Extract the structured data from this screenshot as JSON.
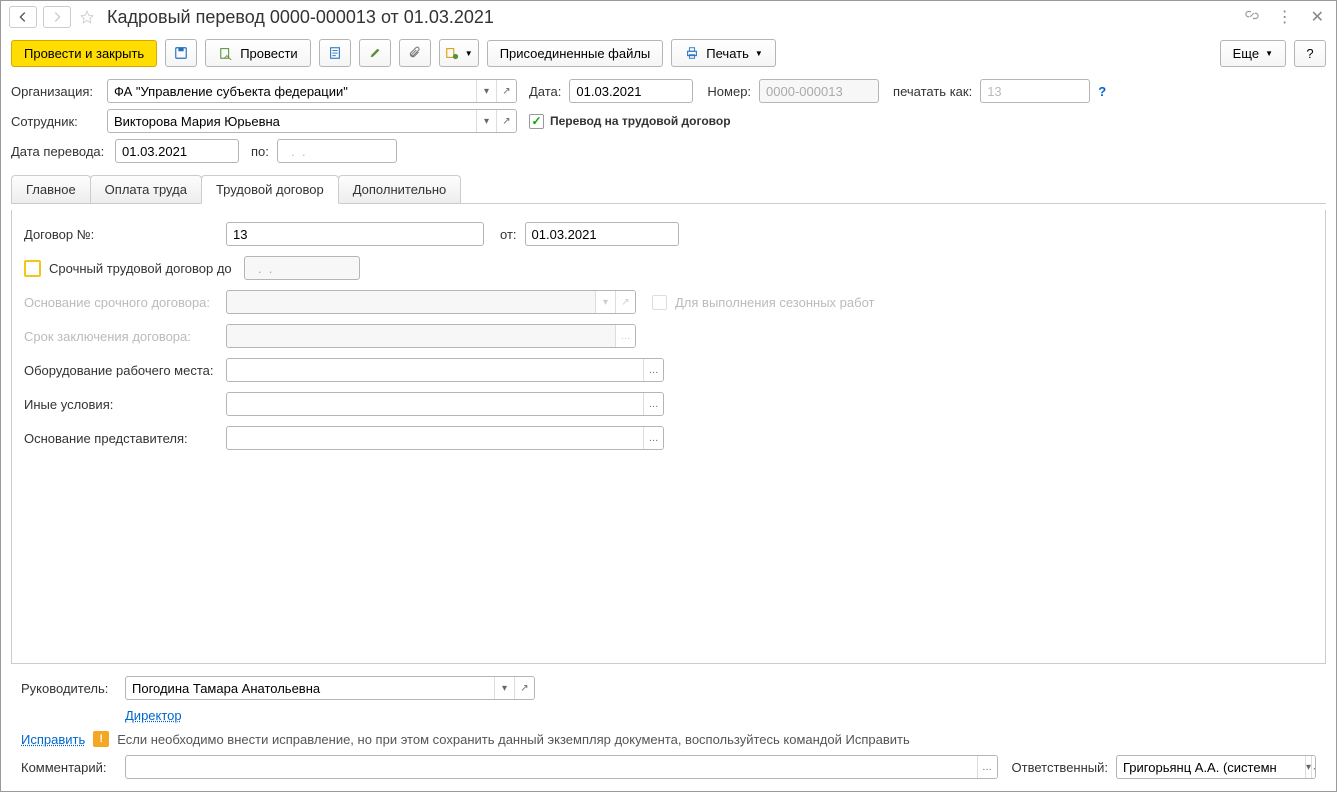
{
  "window": {
    "title": "Кадровый перевод 0000-000013 от 01.03.2021"
  },
  "toolbar": {
    "post_close": "Провести и закрыть",
    "post": "Провести",
    "attachments": "Присоединенные файлы",
    "print": "Печать",
    "more": "Еще",
    "help": "?"
  },
  "header": {
    "org_label": "Организация:",
    "org_value": "ФА \"Управление субъекта федерации\"",
    "date_label": "Дата:",
    "date_value": "01.03.2021",
    "number_label": "Номер:",
    "number_value": "0000-000013",
    "print_as_label": "печатать как:",
    "print_as_value": "13",
    "employee_label": "Сотрудник:",
    "employee_value": "Викторова Мария Юрьевна",
    "transfer_to_contract": "Перевод на трудовой договор",
    "transfer_date_label": "Дата перевода:",
    "transfer_date_value": "01.03.2021",
    "to_label": "по:",
    "to_value": "  .  .    "
  },
  "tabs": {
    "main": "Главное",
    "salary": "Оплата труда",
    "contract": "Трудовой договор",
    "extra": "Дополнительно"
  },
  "contract": {
    "num_label": "Договор №:",
    "num_value": "13",
    "from_label": "от:",
    "from_value": "01.03.2021",
    "fixed_term_label": "Срочный трудовой договор до",
    "fixed_term_date": "  .  .    ",
    "basis_label": "Основание срочного договора:",
    "seasonal_label": "Для выполнения сезонных работ",
    "term_label": "Срок заключения договора:",
    "equipment_label": "Оборудование рабочего места:",
    "other_label": "Иные условия:",
    "rep_basis_label": "Основание представителя:"
  },
  "footer": {
    "manager_label": "Руководитель:",
    "manager_value": "Погодина Тамара Анатольевна",
    "manager_position": "Директор",
    "correct_link": "Исправить",
    "correct_text": "Если необходимо внести исправление, но при этом сохранить данный экземпляр документа, воспользуйтесь командой Исправить",
    "comment_label": "Комментарий:",
    "responsible_label": "Ответственный:",
    "responsible_value": "Григорьянц А.А. (системн"
  }
}
